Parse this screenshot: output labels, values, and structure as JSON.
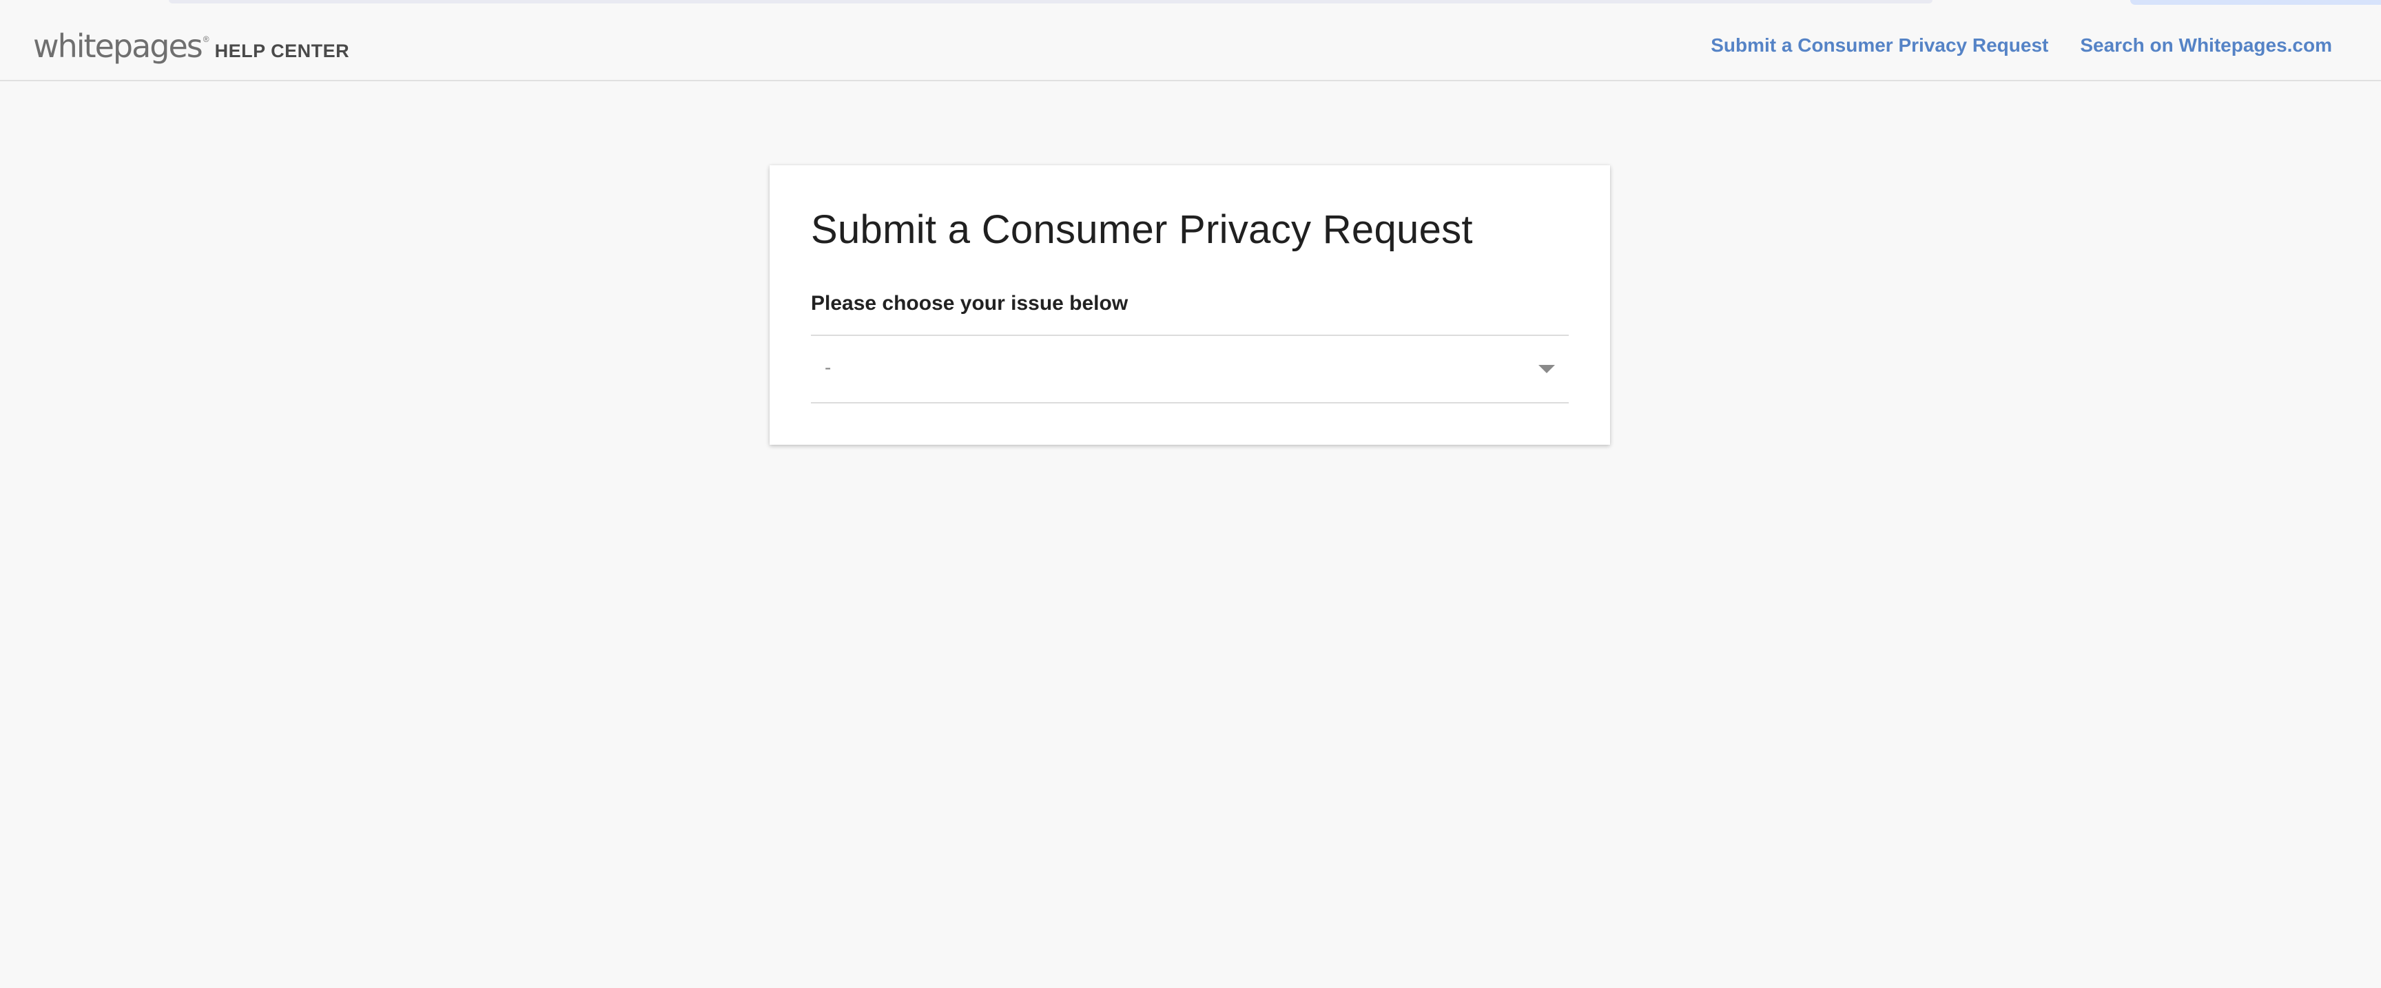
{
  "header": {
    "logo_wordmark": "whitepages",
    "logo_trademark": "®",
    "logo_subtitle": "HELP CENTER",
    "nav": {
      "privacy_request_link": "Submit a Consumer Privacy Request",
      "search_link": "Search on Whitepages.com"
    }
  },
  "form": {
    "title": "Submit a Consumer Privacy Request",
    "issue_label": "Please choose your issue below",
    "issue_select": {
      "selected_value": "-"
    }
  },
  "colors": {
    "link": "#5583c6",
    "background": "#f8f8f8",
    "card": "#ffffff"
  }
}
